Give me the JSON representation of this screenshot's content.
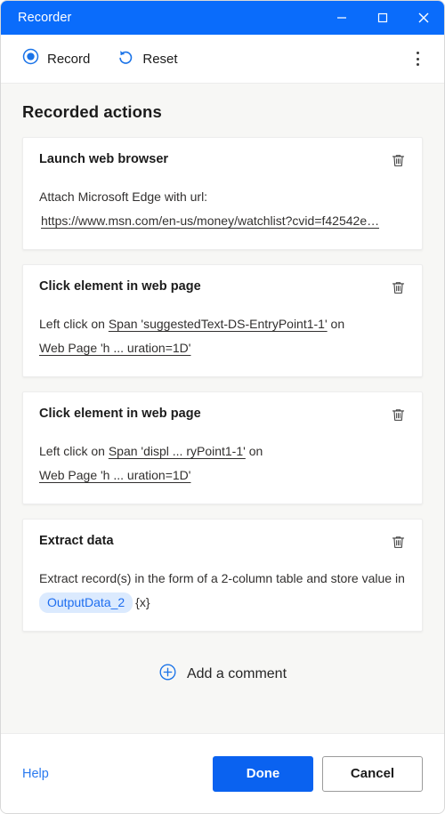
{
  "window": {
    "title": "Recorder",
    "controls": {
      "minimize": "minimize-icon",
      "maximize": "maximize-icon",
      "close": "close-icon"
    },
    "titlebar_color": "#0a6cfb"
  },
  "toolbar": {
    "record_label": "Record",
    "record_icon": "record-circle-icon",
    "reset_label": "Reset",
    "reset_icon": "undo-arrow-icon",
    "more_icon": "kebab-menu-icon",
    "accent_color": "#1a73e8"
  },
  "main": {
    "heading": "Recorded actions",
    "actions": [
      {
        "title": "Launch web browser",
        "delete_icon": "trash-icon",
        "text_prefix": "Attach Microsoft Edge with url:",
        "url": "https://www.msn.com/en-us/money/watchlist?cvid=f42542e…"
      },
      {
        "title": "Click element in web page",
        "delete_icon": "trash-icon",
        "line1_prefix": "Left click on",
        "line1_target": "Span 'suggestedText-DS-EntryPoint1-1'",
        "line1_suffix": "on",
        "line2_target": "Web Page 'h ... uration=1D'"
      },
      {
        "title": "Click element in web page",
        "delete_icon": "trash-icon",
        "line1_prefix": "Left click on",
        "line1_target": "Span 'displ ... ryPoint1-1'",
        "line1_suffix": "on",
        "line2_target": "Web Page 'h ... uration=1D'"
      },
      {
        "title": "Extract data",
        "delete_icon": "trash-icon",
        "text_prefix": "Extract record(s) in the form of a 2-column table and store value in",
        "variable": "OutputData_2",
        "variable_suffix": "{x}",
        "chip_bg": "#dbeafe",
        "chip_color": "#1e6ef0"
      }
    ],
    "add_comment_label": "Add a comment",
    "add_comment_icon": "plus-circle-icon"
  },
  "footer": {
    "help_label": "Help",
    "done_label": "Done",
    "cancel_label": "Cancel",
    "primary_color": "#0a62f0"
  }
}
